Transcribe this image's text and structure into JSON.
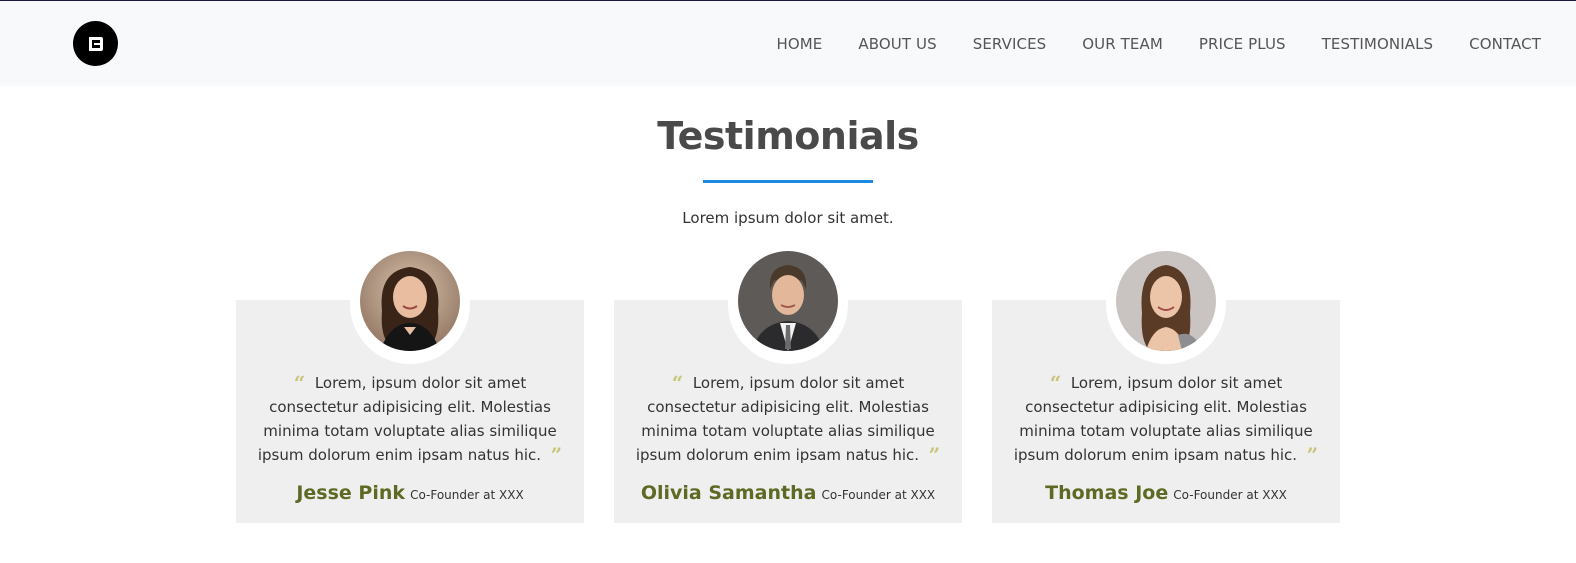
{
  "nav": {
    "logo_icon": "brand-logo-icon",
    "items": [
      {
        "label": "HOME"
      },
      {
        "label": "ABOUT US"
      },
      {
        "label": "SERVICES"
      },
      {
        "label": "OUR TEAM"
      },
      {
        "label": "PRICE PLUS"
      },
      {
        "label": "TESTIMONIALS"
      },
      {
        "label": "CONTACT"
      }
    ]
  },
  "section": {
    "title": "Testimonials",
    "subtitle": "Lorem ipsum dolor sit amet.",
    "accent_color": "#1e88e5",
    "quote_color": "#c8c57a",
    "name_color": "#5d6a23"
  },
  "testimonials": [
    {
      "text": "Lorem, ipsum dolor sit amet consectetur adipisicing elit. Molestias minima totam voluptate alias similique ipsum dolorum enim ipsam natus hic.",
      "name": "Jesse Pink",
      "role": "Co-Founder at XXX"
    },
    {
      "text": "Lorem, ipsum dolor sit amet consectetur adipisicing elit. Molestias minima totam voluptate alias similique ipsum dolorum enim ipsam natus hic.",
      "name": "Olivia Samantha",
      "role": "Co-Founder at XXX"
    },
    {
      "text": "Lorem, ipsum dolor sit amet consectetur adipisicing elit. Molestias minima totam voluptate alias similique ipsum dolorum enim ipsam natus hic.",
      "name": "Thomas Joe",
      "role": "Co-Founder at XXX"
    }
  ]
}
